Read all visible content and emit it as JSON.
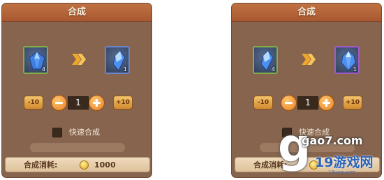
{
  "panels": [
    {
      "title": "合成",
      "input_count": "4",
      "output_count": "1",
      "minus10_label": "-10",
      "plus10_label": "+10",
      "quantity": "1",
      "quick_label": "快速合成",
      "cost_label": "合成消耗:",
      "cost_value": "1000",
      "output_color": "#6b86c8"
    },
    {
      "title": "合成",
      "input_count": "4",
      "output_count": "1",
      "minus10_label": "-10",
      "plus10_label": "+10",
      "quantity": "1",
      "quick_label": "快速合成",
      "cost_label": "合成消耗:",
      "output_color": "#a05bc7"
    }
  ],
  "watermark": {
    "glyph": "g",
    "domain": "gao7.com",
    "site": "19游戏网",
    "url": "19yxw.com"
  },
  "icons": [
    "blue-gem-icon",
    "blue-crystal-icon",
    "purple-crystal-icon",
    "double-arrow-icon",
    "minus-icon",
    "plus-icon",
    "coin-icon"
  ],
  "colors": {
    "panel": "#86644d",
    "header": "#b36039",
    "button": "#e29a3f",
    "cost_bar": "#e8cfad"
  }
}
